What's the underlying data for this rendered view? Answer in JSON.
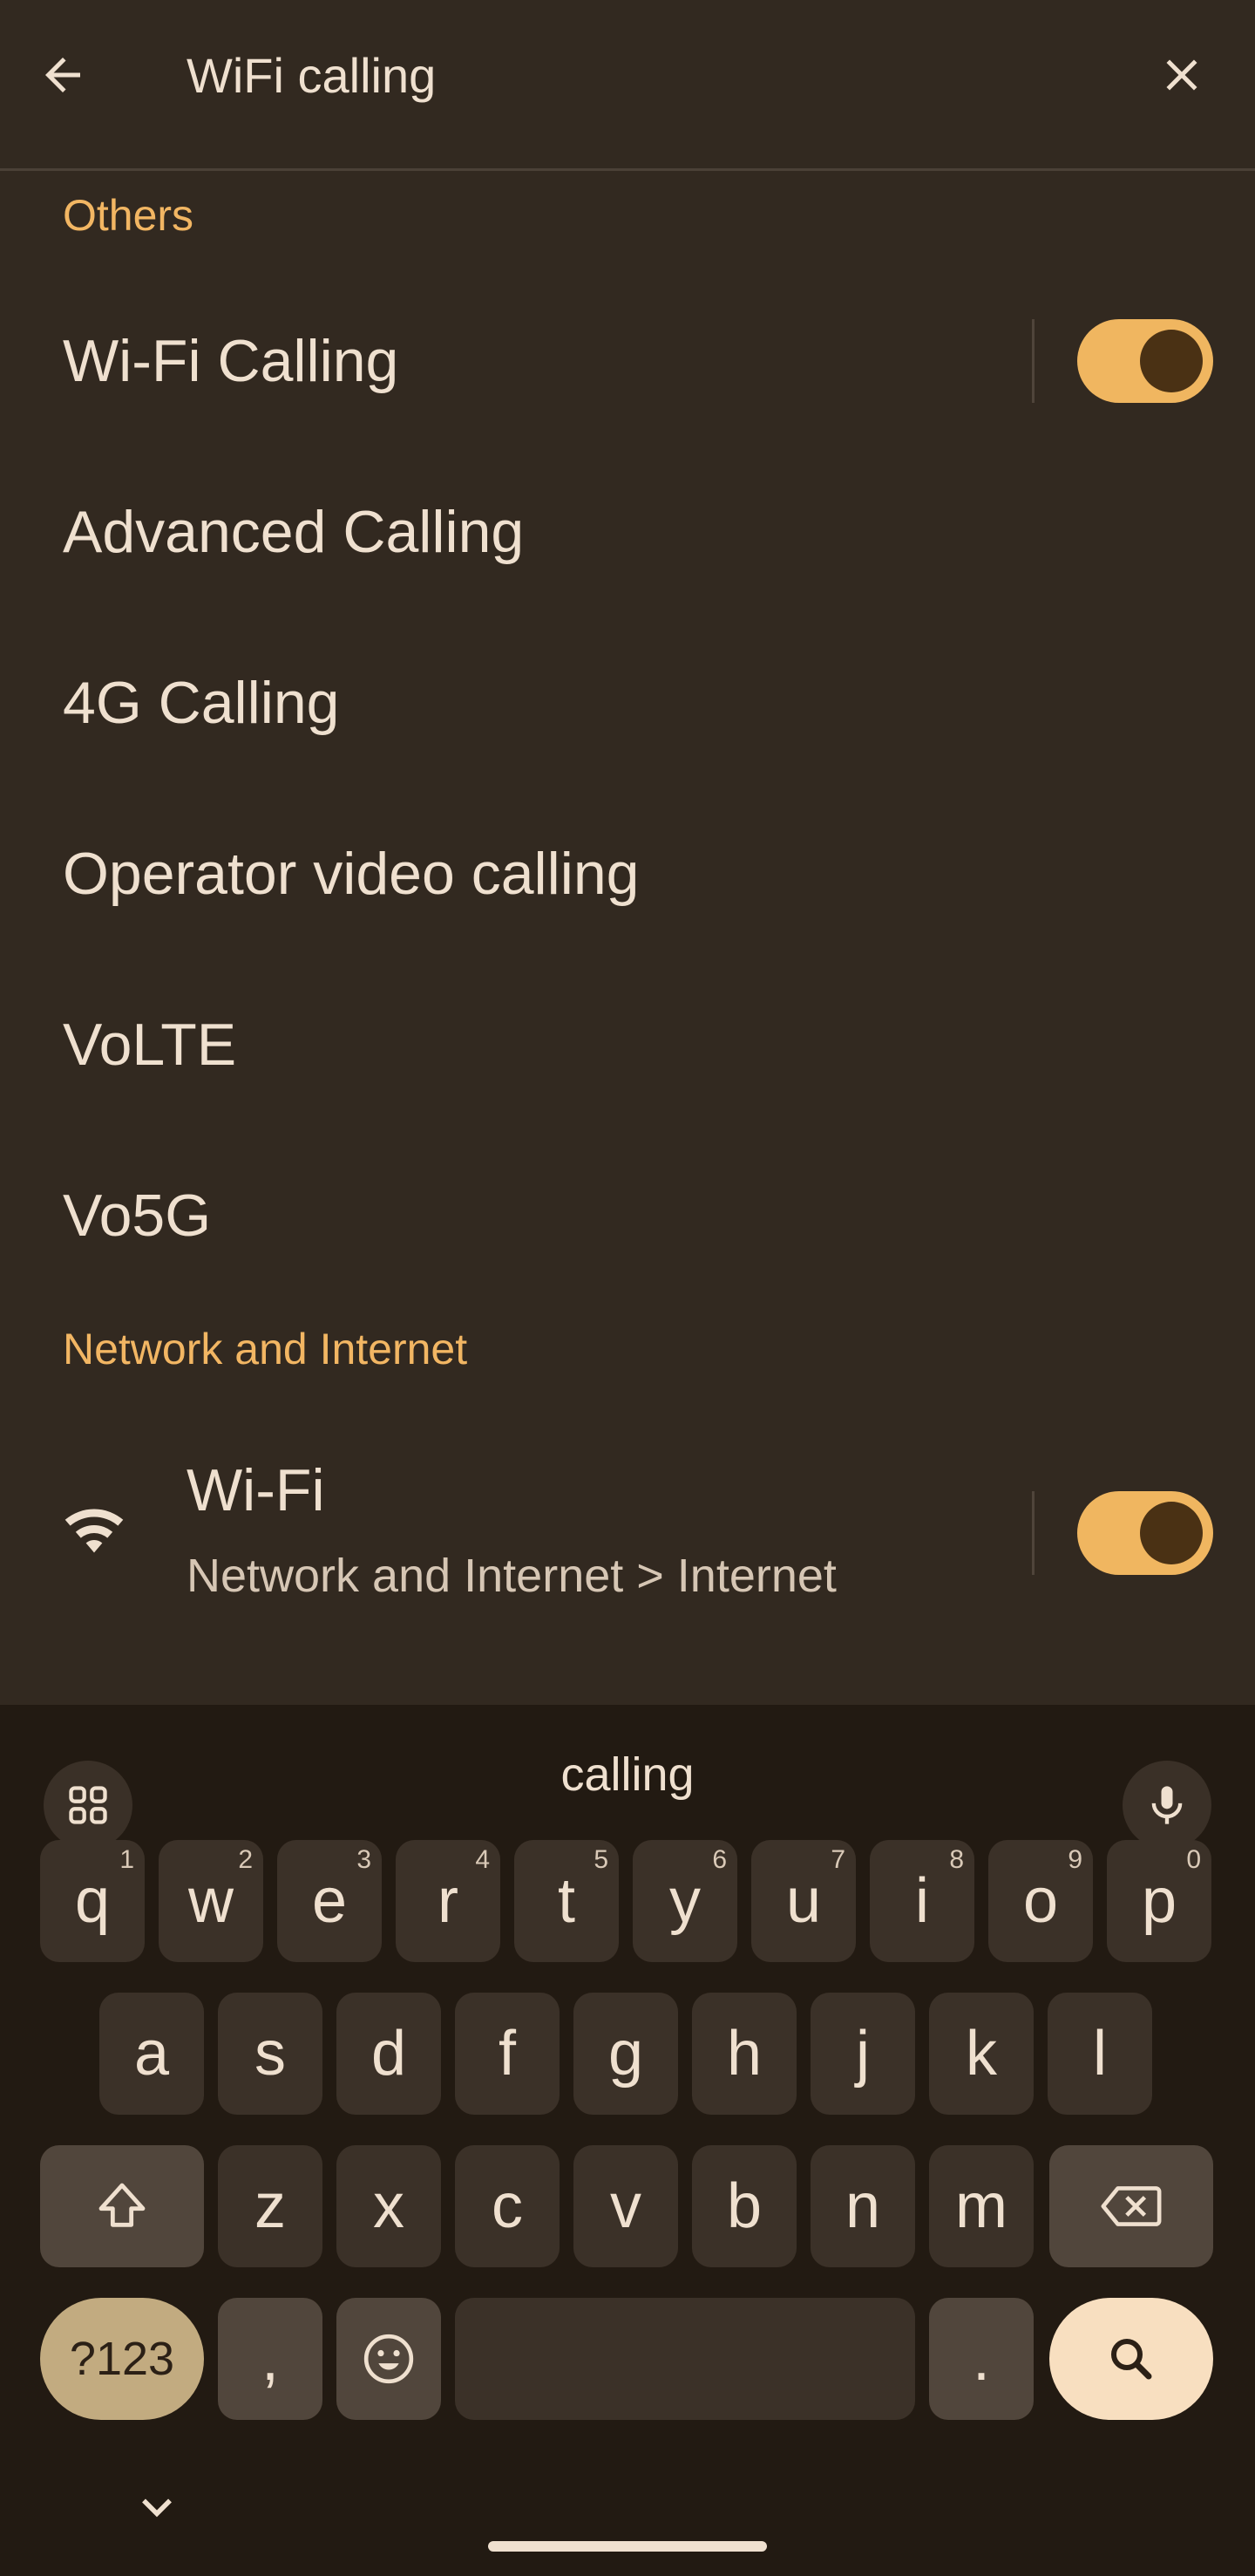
{
  "search": {
    "query": "WiFi calling"
  },
  "sections": {
    "others": "Others",
    "network": "Network and Internet"
  },
  "results": {
    "wifi_calling": {
      "title": "Wi-Fi Calling",
      "toggle_on": true
    },
    "advanced_calling": {
      "title": "Advanced Calling"
    },
    "calling_4g": {
      "title": "4G Calling"
    },
    "operator_video": {
      "title": "Operator video calling"
    },
    "volte": {
      "title": "VoLTE"
    },
    "vo5g": {
      "title": "Vo5G"
    },
    "wifi": {
      "title": "Wi-Fi",
      "subtitle": "Network and Internet > Internet",
      "toggle_on": true
    }
  },
  "keyboard": {
    "suggestion": "calling",
    "row1": [
      {
        "k": "q",
        "h": "1"
      },
      {
        "k": "w",
        "h": "2"
      },
      {
        "k": "e",
        "h": "3"
      },
      {
        "k": "r",
        "h": "4"
      },
      {
        "k": "t",
        "h": "5"
      },
      {
        "k": "y",
        "h": "6"
      },
      {
        "k": "u",
        "h": "7"
      },
      {
        "k": "i",
        "h": "8"
      },
      {
        "k": "o",
        "h": "9"
      },
      {
        "k": "p",
        "h": "0"
      }
    ],
    "row2": [
      "a",
      "s",
      "d",
      "f",
      "g",
      "h",
      "j",
      "k",
      "l"
    ],
    "row3": [
      "z",
      "x",
      "c",
      "v",
      "b",
      "n",
      "m"
    ],
    "symbols_label": "?123",
    "comma": ",",
    "period": "."
  },
  "colors": {
    "background": "#322920",
    "accent": "#f2b663",
    "keyboard_bg": "#221a12"
  }
}
